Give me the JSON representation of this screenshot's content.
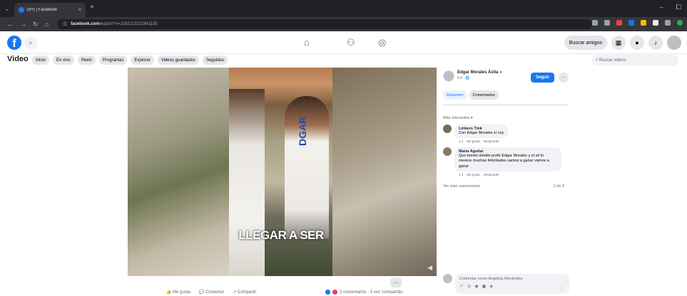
{
  "browser": {
    "tab_title": "(9+) | Facebook",
    "tab_close": "×",
    "new_tab": "+",
    "window_controls": [
      "–",
      "⧠"
    ],
    "address_domain": "facebook.com",
    "address_path": "/watch/?v=1182113221841135",
    "nav_icons": [
      "back-icon",
      "forward-icon",
      "reload-icon",
      "home-icon"
    ],
    "extension_colors": [
      "#9aa0a6",
      "#9aa0a6",
      "#ea4335",
      "#1a73e8",
      "#fbbc04",
      "#e8eaed",
      "#9aa0a6",
      "#34a853"
    ]
  },
  "facebook": {
    "logo": "f",
    "find_friends": "Buscar amigos",
    "nav_icons": [
      "home-icon",
      "friends-icon",
      "gaming-icon"
    ]
  },
  "video_nav": {
    "title": "Video",
    "pills": [
      "Inicio",
      "En vivo",
      "Reels",
      "Programas",
      "Explorar",
      "Videos guardados",
      "Seguidos"
    ],
    "search_placeholder": "Buscar videos"
  },
  "video": {
    "caption": "LLEGAR A SER",
    "shirt_text": "DGAR"
  },
  "actions": {
    "like": "Me gusta",
    "comment": "Comentar",
    "share": "Compartir",
    "more": "···",
    "reactions_summary": "2 comentarios · 5 vez compartido"
  },
  "panel": {
    "author_name": "Edgar Morales Ávila",
    "verified": "●",
    "author_meta": "5 d · 🌐",
    "follow": "Seguir",
    "more": "···",
    "tab_summary": "Resumen",
    "tab_comments": "Comentarios",
    "sort_label": "Más relevantes ▾",
    "comments": [
      {
        "name": "Lirikers Tmk",
        "text": "Con Edgar Morales sí voy",
        "meta": [
          "1 d",
          "Me gusta",
          "Responder"
        ]
      },
      {
        "name": "Maria Aguilar",
        "text": "Que bonito detalle profe Edgar Morales y sí sé lo merece muchas felicidades vamos a ganar vamos a ganar",
        "meta": [
          "1 d",
          "Me gusta",
          "Responder"
        ]
      }
    ],
    "more_comments": "Ver más comentarios",
    "comment_count": "2 de 3",
    "composer_placeholder": "Comentar como Angélica Menéndez",
    "send_icon": "▷"
  },
  "colors": {
    "brand": "#1877f2",
    "chrome_dark": "#202124"
  }
}
